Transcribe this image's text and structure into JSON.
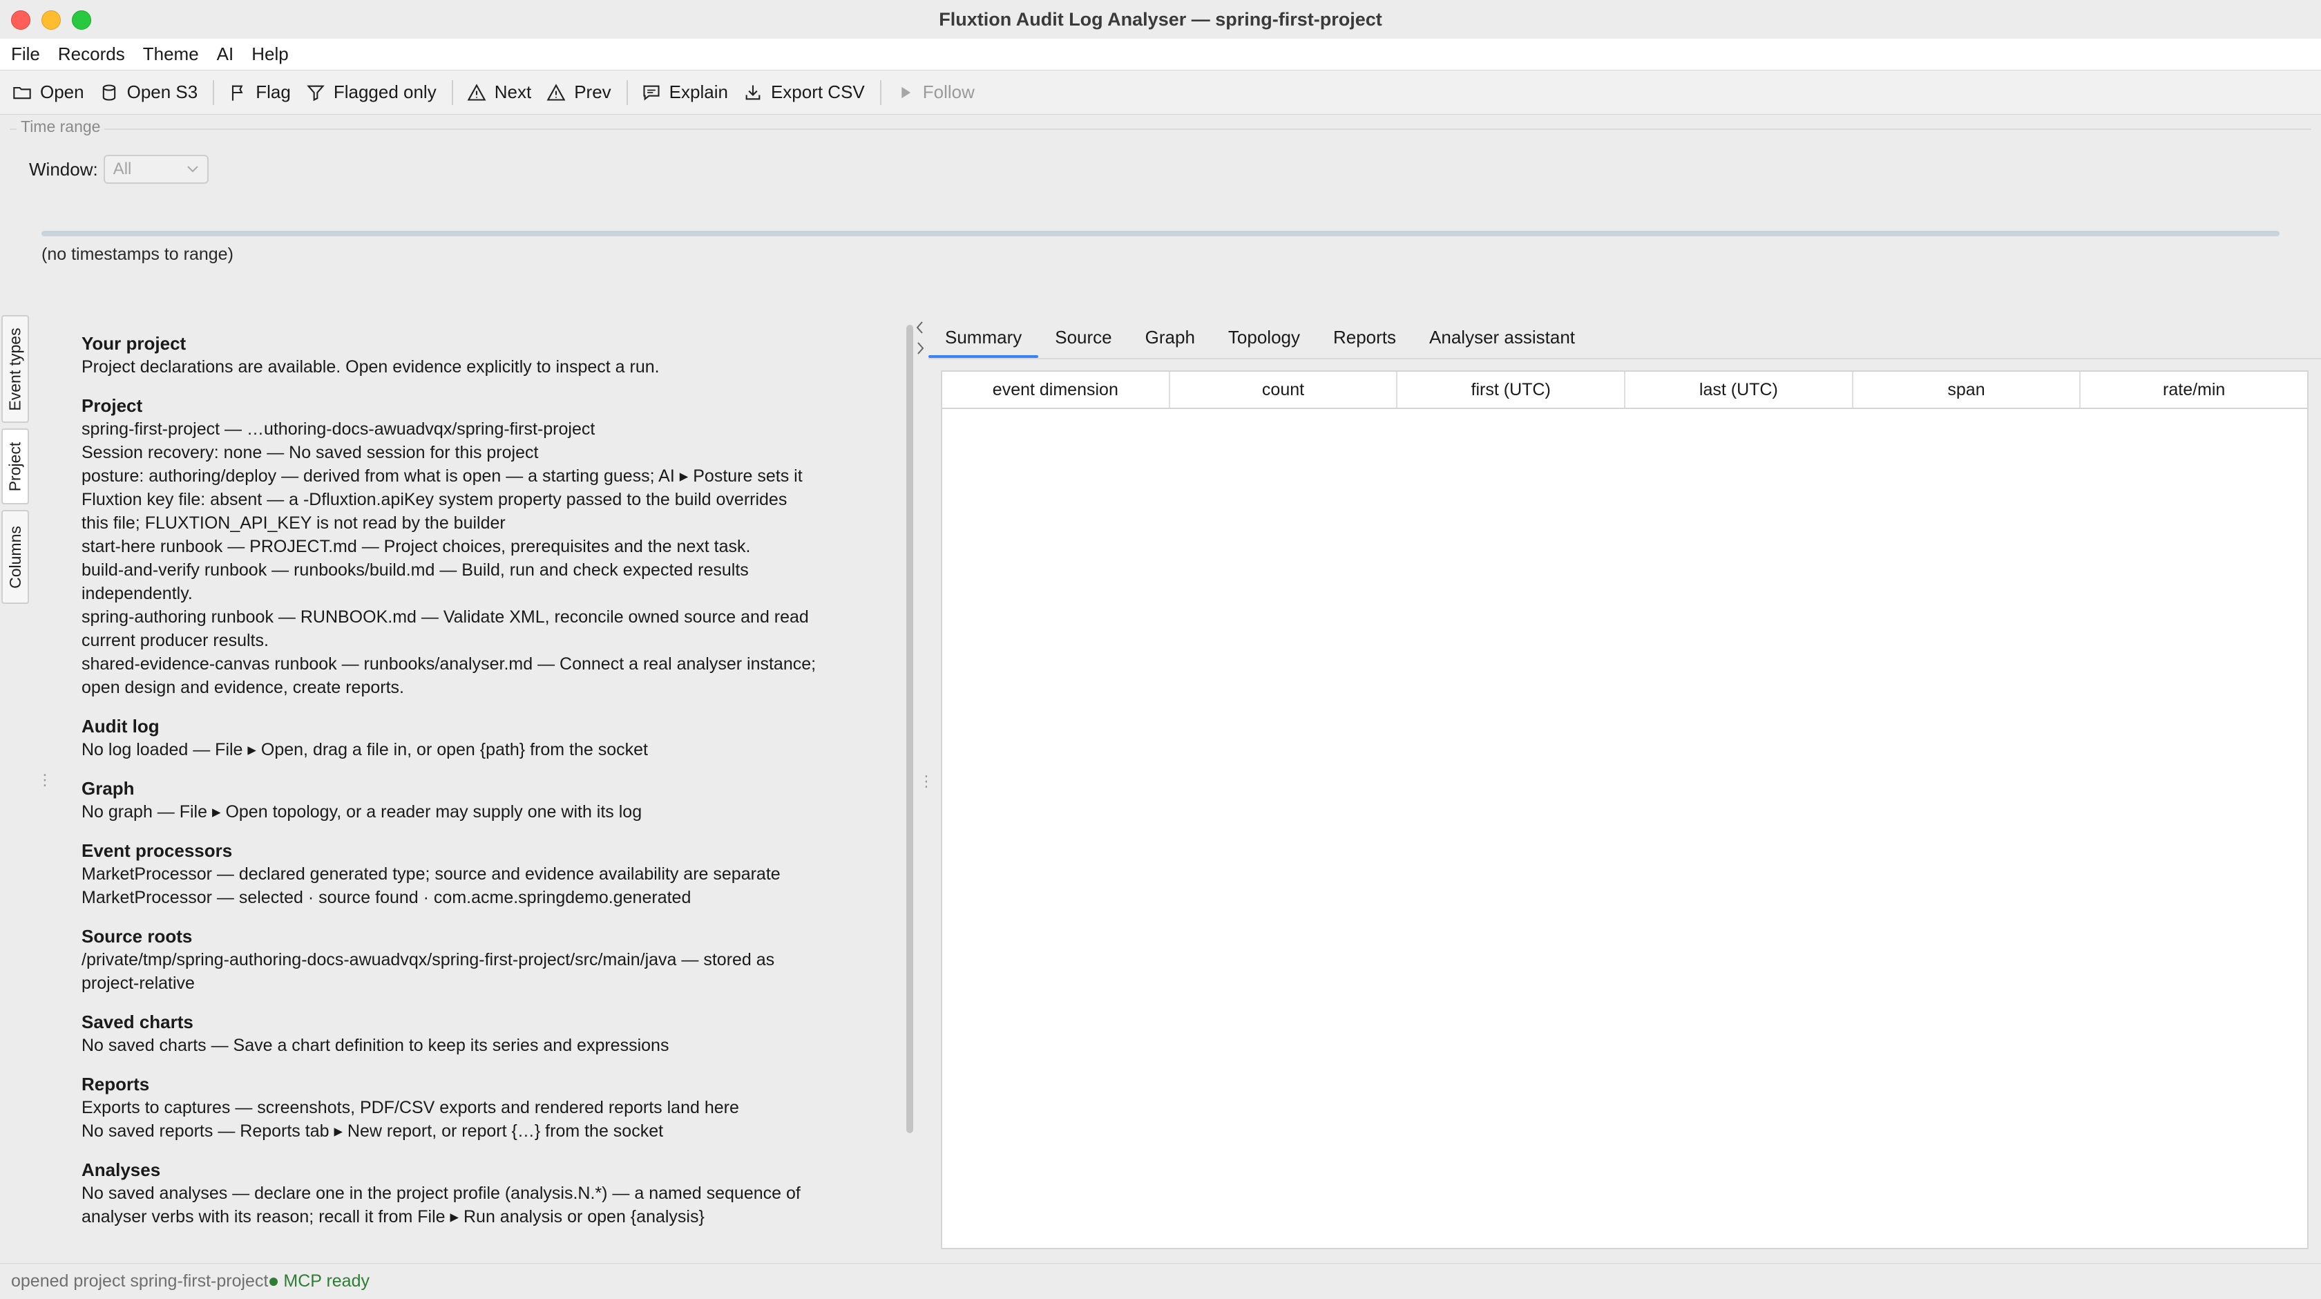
{
  "window": {
    "title": "Fluxtion Audit Log Analyser — spring-first-project"
  },
  "menu": [
    "File",
    "Records",
    "Theme",
    "AI",
    "Help"
  ],
  "toolbar": {
    "open": "Open",
    "open_s3": "Open S3",
    "flag": "Flag",
    "flagged_only": "Flagged only",
    "next": "Next",
    "prev": "Prev",
    "explain": "Explain",
    "export_csv": "Export CSV",
    "follow": "Follow"
  },
  "time_range": {
    "legend": "Time range",
    "window_label": "Window:",
    "window_value": "All",
    "note": "(no timestamps to range)"
  },
  "side_tabs": [
    "Event types",
    "Project",
    "Columns"
  ],
  "project": {
    "sections": [
      {
        "title": "Your project",
        "lines": [
          "Project declarations are available. Open evidence explicitly to inspect a run."
        ]
      },
      {
        "title": "Project",
        "lines": [
          "spring-first-project — …uthoring-docs-awuadvqx/spring-first-project",
          "Session recovery: none — No saved session for this project",
          "posture: authoring/deploy — derived from what is open — a starting guess; AI ▸ Posture sets it",
          "Fluxtion key file: absent — a -Dfluxtion.apiKey system property passed to the build overrides",
          "this file; FLUXTION_API_KEY is not read by the builder",
          "start-here runbook — PROJECT.md — Project choices, prerequisites and the next task.",
          "build-and-verify runbook — runbooks/build.md — Build, run and check expected results",
          "independently.",
          "spring-authoring runbook — RUNBOOK.md — Validate XML, reconcile owned source and read",
          "current producer results.",
          "shared-evidence-canvas runbook — runbooks/analyser.md — Connect a real analyser instance;",
          "open design and evidence, create reports."
        ]
      },
      {
        "title": "Audit log",
        "lines": [
          "No log loaded — File ▸ Open, drag a file in, or open {path} from the socket"
        ]
      },
      {
        "title": "Graph",
        "lines": [
          "No graph — File ▸ Open topology, or a reader may supply one with its log"
        ]
      },
      {
        "title": "Event processors",
        "lines": [
          "MarketProcessor — declared generated type; source and evidence availability are separate",
          "MarketProcessor — selected · source found · com.acme.springdemo.generated"
        ]
      },
      {
        "title": "Source roots",
        "lines": [
          "/private/tmp/spring-authoring-docs-awuadvqx/spring-first-project/src/main/java — stored as",
          "project-relative"
        ]
      },
      {
        "title": "Saved charts",
        "lines": [
          "No saved charts — Save a chart definition to keep its series and expressions"
        ]
      },
      {
        "title": "Reports",
        "lines": [
          "Exports to captures — screenshots, PDF/CSV exports and rendered reports land here",
          "No saved reports — Reports tab ▸ New report, or report {…} from the socket"
        ]
      },
      {
        "title": "Analyses",
        "lines": [
          "No saved analyses — declare one in the project profile (analysis.N.*) — a named sequence of",
          "analyser verbs with its reason; recall it from File ▸ Run analysis or open {analysis}"
        ]
      }
    ]
  },
  "tabs": [
    "Summary",
    "Source",
    "Graph",
    "Topology",
    "Reports",
    "Analyser assistant"
  ],
  "active_tab": "Summary",
  "summary_table": {
    "columns": [
      "event dimension",
      "count",
      "first (UTC)",
      "last (UTC)",
      "span",
      "rate/min"
    ],
    "rows": []
  },
  "status": {
    "message": "opened project spring-first-project",
    "mcp": "MCP ready",
    "mcp_color": "#2e7d32"
  },
  "colors": {
    "accent": "#3b82f6",
    "mcp_ready": "#2e7d32"
  }
}
